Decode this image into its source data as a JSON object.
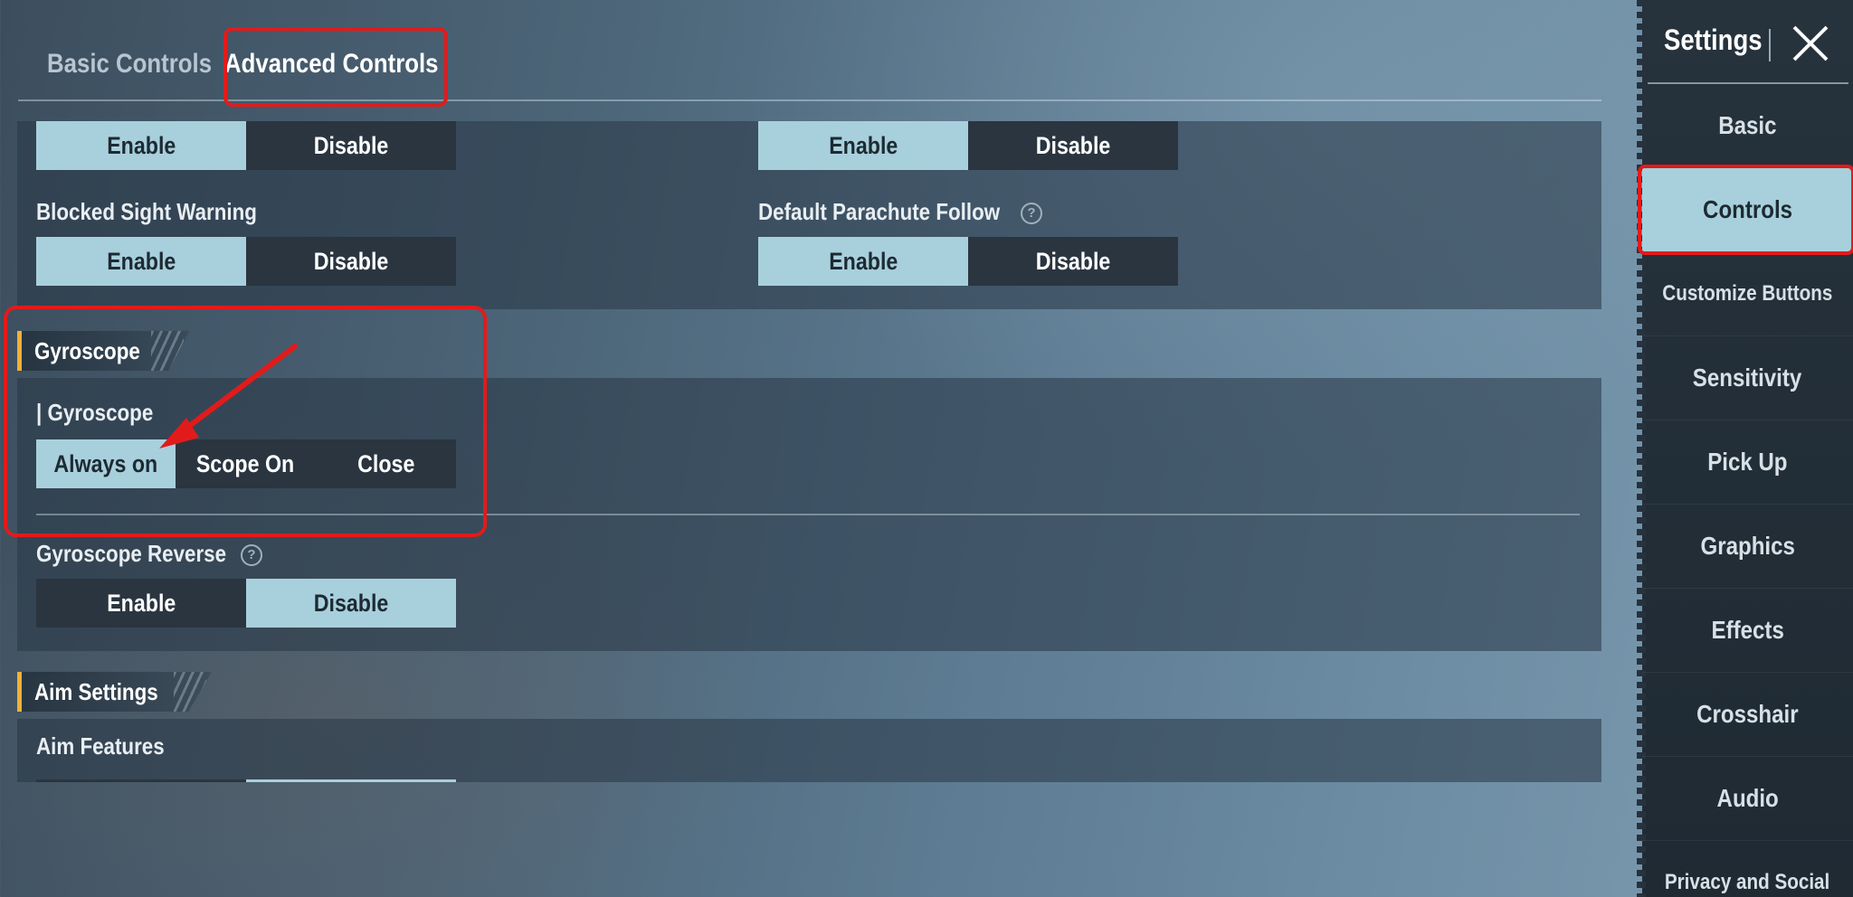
{
  "top_tabs": [
    {
      "label": "Basic Controls"
    },
    {
      "label": "Advanced Controls"
    }
  ],
  "panel1": {
    "row1_left": {
      "options": [
        "Enable",
        "Disable"
      ],
      "selected": "Enable"
    },
    "row1_right": {
      "options": [
        "Enable",
        "Disable"
      ],
      "selected": "Enable"
    },
    "blocked_sight": {
      "label": "Blocked Sight Warning",
      "options": [
        "Enable",
        "Disable"
      ],
      "selected": "Enable"
    },
    "parachute": {
      "label": "Default Parachute Follow",
      "help": "?",
      "options": [
        "Enable",
        "Disable"
      ],
      "selected": "Enable"
    }
  },
  "gyroscope_section": {
    "title": "Gyroscope",
    "gyroscope": {
      "label": "| Gyroscope",
      "options": [
        "Always on",
        "Scope On",
        "Close"
      ],
      "selected": "Always on"
    },
    "reverse": {
      "label": "Gyroscope Reverse",
      "help": "?",
      "options": [
        "Enable",
        "Disable"
      ],
      "selected": "Disable"
    }
  },
  "aim_section": {
    "title": "Aim Settings",
    "aim_features": {
      "label": "Aim Features"
    }
  },
  "sidebar": {
    "title": "Settings",
    "close_icon": "close-icon",
    "items": [
      {
        "label": "Basic"
      },
      {
        "label": "Controls"
      },
      {
        "label": "Customize Buttons"
      },
      {
        "label": "Sensitivity"
      },
      {
        "label": "Pick Up"
      },
      {
        "label": "Graphics"
      },
      {
        "label": "Effects"
      },
      {
        "label": "Crosshair"
      },
      {
        "label": "Audio"
      },
      {
        "label": "Privacy and Social"
      }
    ],
    "active": "Controls"
  },
  "colors": {
    "accent": "#a8d0dc",
    "annotation": "#e11b1b",
    "section_marker": "#f0b13a",
    "option_bg": "#2a3540"
  }
}
